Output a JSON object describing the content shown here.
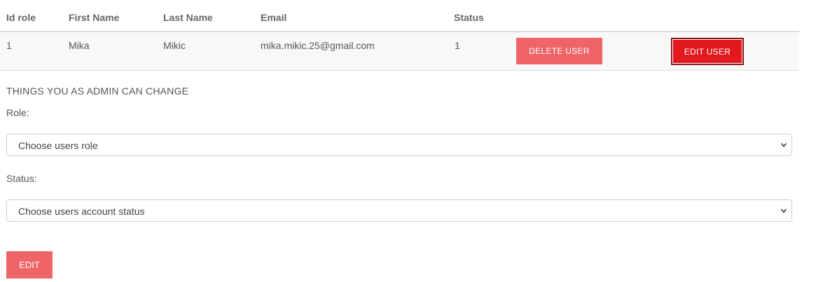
{
  "table": {
    "headers": [
      "Id role",
      "First Name",
      "Last Name",
      "Email",
      "Status"
    ],
    "rows": [
      {
        "id_role": "1",
        "first_name": "Mika",
        "last_name": "Mikic",
        "email": "mika.mikic.25@gmail.com",
        "status": "1",
        "delete_label": "DELETE USER",
        "edit_label": "EDIT USER"
      }
    ]
  },
  "admin_form": {
    "section_title": "THINGS YOU AS ADMIN CAN CHANGE",
    "role_label": "Role:",
    "role_select_value": "Choose users role",
    "status_label": "Status:",
    "status_select_value": "Choose users account status",
    "submit_label": "EDIT"
  },
  "colors": {
    "delete_button": "#ef6467",
    "edit_user_button": "#e2181d",
    "edit_button": "#ef6467"
  }
}
